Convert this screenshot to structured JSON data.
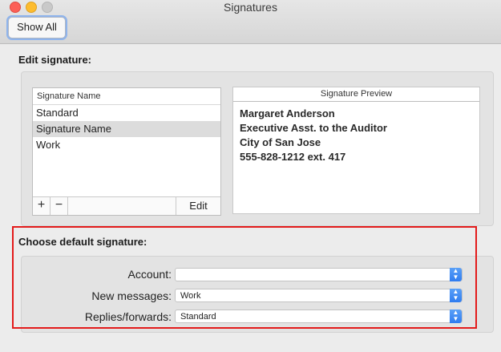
{
  "window": {
    "title": "Signatures",
    "show_all_label": "Show All"
  },
  "edit_signature": {
    "section_label": "Edit signature:",
    "list_header": "Signature Name",
    "items": [
      {
        "label": "Standard",
        "selected": false
      },
      {
        "label": "Signature Name",
        "selected": true
      },
      {
        "label": "Work",
        "selected": false
      }
    ],
    "add_label": "+",
    "remove_label": "−",
    "edit_label": "Edit"
  },
  "preview": {
    "header": "Signature Preview",
    "lines": [
      "Margaret Anderson",
      "Executive Asst. to the Auditor",
      "City of San Jose",
      "555-828-1212 ext. 417"
    ]
  },
  "default_signature": {
    "section_label": "Choose default signature:",
    "account_label": "Account:",
    "account_value": "",
    "new_messages_label": "New messages:",
    "new_messages_value": "Work",
    "replies_label": "Replies/forwards:",
    "replies_value": "Standard"
  },
  "colors": {
    "highlight": "#e31b1b",
    "accent": "#2f7cf0"
  },
  "icons": {
    "close": "close-icon",
    "minimize": "minimize-icon",
    "zoom": "zoom-icon",
    "popup": "chevron-updown-icon"
  }
}
